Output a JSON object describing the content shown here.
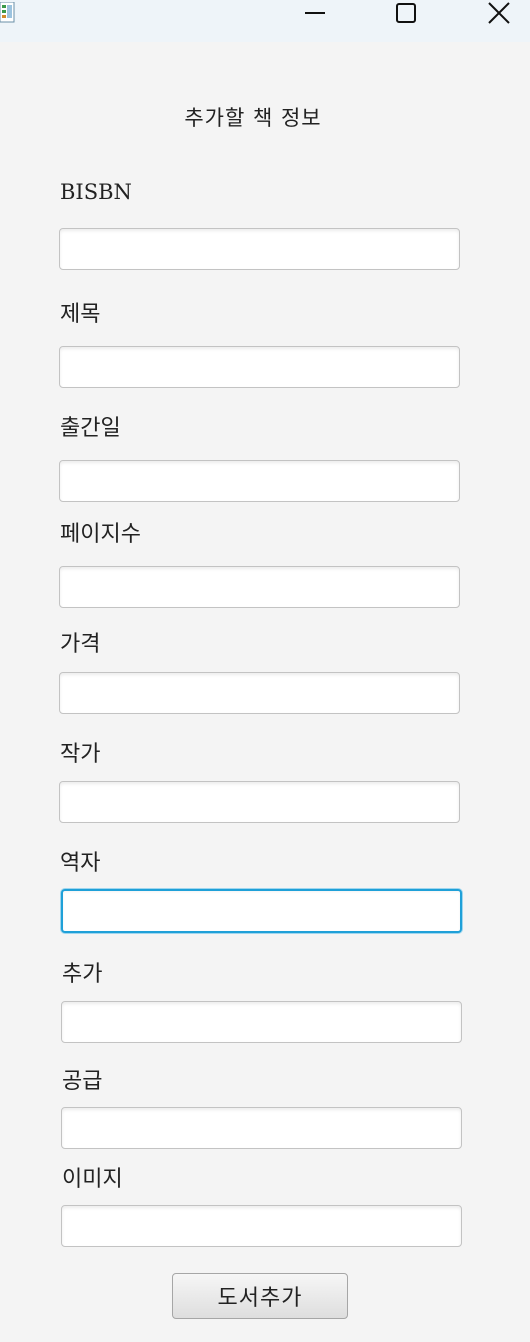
{
  "window": {
    "app_icon": "app-icon",
    "controls": [
      "minimize-icon",
      "maximize-icon",
      "close-icon"
    ]
  },
  "form": {
    "title": "추가할 책 정보",
    "fields": [
      {
        "label": "BISBN",
        "value": ""
      },
      {
        "label": "제목",
        "value": ""
      },
      {
        "label": "출간일",
        "value": ""
      },
      {
        "label": "페이지수",
        "value": ""
      },
      {
        "label": "가격",
        "value": ""
      },
      {
        "label": "작가",
        "value": ""
      },
      {
        "label": "역자",
        "value": ""
      },
      {
        "label": "추가",
        "value": ""
      },
      {
        "label": "공급",
        "value": ""
      },
      {
        "label": "이미지",
        "value": ""
      }
    ],
    "focused_field": "역자",
    "submit_label": "도서추가"
  },
  "colors": {
    "background": "#f4f4f4",
    "titlebar": "#eef4f9",
    "focus_border": "#1fa0d8"
  }
}
